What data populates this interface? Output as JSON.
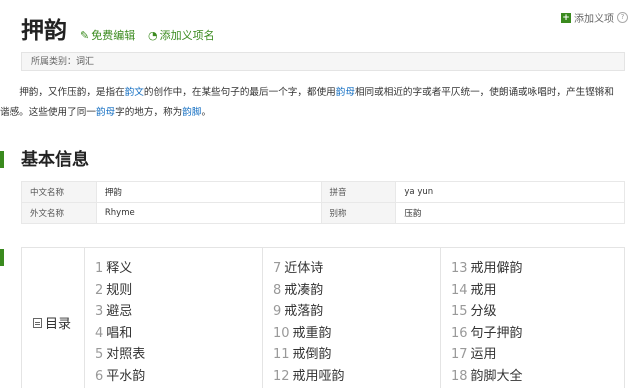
{
  "header": {
    "title": "押韵",
    "edit_label": "免费编辑",
    "add_name_label": "添加义项名",
    "add_item_label": "添加义项",
    "help_glyph": "?"
  },
  "category": {
    "label": "所属类别：",
    "value": "词汇"
  },
  "summary": {
    "parts": [
      "押韵，又作压韵，是指在",
      "韵文",
      "的创作中，在某些句子的最后一个字，都使用",
      "韵母",
      "相同或相近的字或者平仄统一，使朗诵或咏唱时，产生铿锵和谐感。这些使用了同一",
      "韵母",
      "字的地方，称为",
      "韵脚",
      "。"
    ]
  },
  "basic_info": {
    "title": "基本信息",
    "rows": [
      [
        {
          "k": "中文名称",
          "v": "押韵"
        },
        {
          "k": "拼音",
          "v": "ya yun"
        }
      ],
      [
        {
          "k": "外文名称",
          "v": "Rhyme"
        },
        {
          "k": "别称",
          "v": "压韵"
        }
      ]
    ]
  },
  "toc": {
    "label": "目录",
    "columns": [
      [
        {
          "n": "1",
          "t": "释义"
        },
        {
          "n": "2",
          "t": "规则"
        },
        {
          "n": "3",
          "t": "避忌"
        },
        {
          "n": "4",
          "t": "唱和"
        },
        {
          "n": "5",
          "t": "对照表"
        },
        {
          "n": "6",
          "t": "平水韵"
        }
      ],
      [
        {
          "n": "7",
          "t": "近体诗"
        },
        {
          "n": "8",
          "t": "戒凑韵"
        },
        {
          "n": "9",
          "t": "戒落韵"
        },
        {
          "n": "10",
          "t": "戒重韵"
        },
        {
          "n": "11",
          "t": "戒倒韵"
        },
        {
          "n": "12",
          "t": "戒用哑韵"
        }
      ],
      [
        {
          "n": "13",
          "t": "戒用僻韵"
        },
        {
          "n": "14",
          "t": "戒用"
        },
        {
          "n": "15",
          "t": "分级"
        },
        {
          "n": "16",
          "t": "句子押韵"
        },
        {
          "n": "17",
          "t": "运用"
        },
        {
          "n": "18",
          "t": "韵脚大全"
        }
      ]
    ]
  },
  "colors": {
    "accent": "#3a8a1e",
    "link": "#136ec2"
  },
  "icons": {
    "edit": "pencil-icon",
    "add_name": "tag-icon",
    "add_item": "plus-icon",
    "help": "help-icon",
    "toc": "book-icon"
  }
}
